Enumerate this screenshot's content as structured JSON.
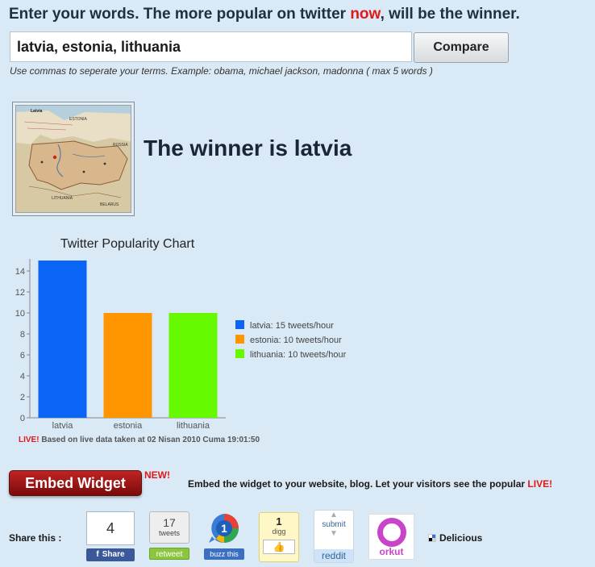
{
  "header": {
    "prefix": "Enter your words. The more popular on twitter ",
    "highlight": "now",
    "suffix": ", will be the winner."
  },
  "search": {
    "value": "latvia, estonia, lithuania",
    "button_label": "Compare",
    "hint": "Use commas to seperate your terms. Example: obama, michael jackson, madonna ( max 5 words )"
  },
  "winner": {
    "text": "The winner is latvia",
    "map": {
      "title": "Latvia",
      "labels": [
        "ESTONIA",
        "RUSSIA",
        "LITHUANIA",
        "BELARUS"
      ]
    }
  },
  "chart_data": {
    "type": "bar",
    "title": "Twitter Popularity Chart",
    "categories": [
      "latvia",
      "estonia",
      "lithuania"
    ],
    "values": [
      15,
      10,
      10
    ],
    "colors": [
      "#0a64f6",
      "#ff9600",
      "#66f900"
    ],
    "legend": [
      "latvia: 15 tweets/hour",
      "estonia: 10 tweets/hour",
      "lithuania: 10 tweets/hour"
    ],
    "legend_position": "right",
    "ylim": [
      0,
      15
    ],
    "yticks": [
      0,
      2,
      4,
      6,
      8,
      10,
      12,
      14
    ],
    "grid": false,
    "xlabel": "",
    "ylabel": ""
  },
  "live_note": {
    "live": "LIVE!",
    "text": " Based on live data taken at 02 Nisan 2010 Cuma 19:01:50"
  },
  "embed": {
    "button_label": "Embed Widget",
    "badge": "NEW!",
    "text": "Embed the widget to your website, blog. Let your visitors see the popular ",
    "live": "LIVE!"
  },
  "share": {
    "label": "Share this :",
    "facebook": {
      "count": "4",
      "label": "Share"
    },
    "twitter": {
      "count": "17",
      "unit": "tweets",
      "label": "retweet"
    },
    "buzz": {
      "count": "1",
      "label": "buzz this"
    },
    "digg": {
      "count": "1",
      "unit": "digg",
      "thumb": "👍"
    },
    "reddit": {
      "label": "submit",
      "foot": "reddit"
    },
    "orkut": {
      "label": "orkut"
    },
    "delicious": {
      "label": "Delicious"
    }
  },
  "colors": {
    "background": "#d9e9f5",
    "accent_red": "#e01818",
    "embed_button": "#a01616"
  },
  "icons": [
    "map-thumbnail",
    "facebook-icon",
    "buzz-bubble-icon",
    "digg-thumb-icon",
    "reddit-arrows-icon",
    "orkut-ring-icon",
    "delicious-icon"
  ]
}
